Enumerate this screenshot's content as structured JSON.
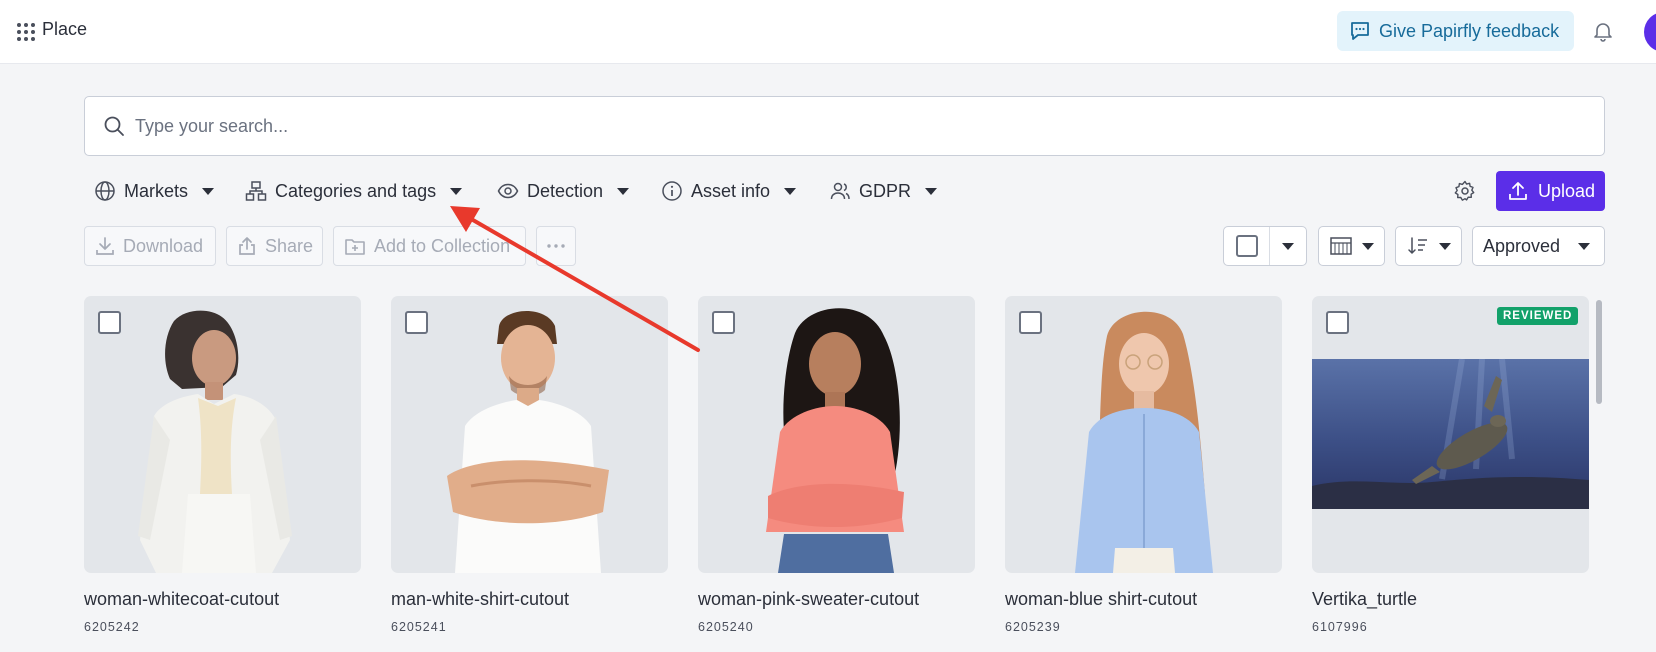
{
  "topbar": {
    "apps_icon": "grid-dots-icon",
    "title": "Place",
    "feedback_label": "Give Papirfly feedback",
    "feedback_icon": "chat-feedback-icon",
    "bell_icon": "bell-icon"
  },
  "search": {
    "placeholder": "Type your search...",
    "value": ""
  },
  "filters": [
    {
      "label": "Markets",
      "icon": "globe-icon"
    },
    {
      "label": "Categories and tags",
      "icon": "hierarchy-icon"
    },
    {
      "label": "Detection",
      "icon": "eye-icon"
    },
    {
      "label": "Asset info",
      "icon": "info-icon"
    },
    {
      "label": "GDPR",
      "icon": "user-icon"
    }
  ],
  "upload_label": "Upload",
  "actions": {
    "download": "Download",
    "share": "Share",
    "add_to_collection": "Add to Collection",
    "more": "more-icon"
  },
  "status_select": {
    "value": "Approved"
  },
  "assets": [
    {
      "name": "woman-whitecoat-cutout",
      "id": "6205242",
      "badge": ""
    },
    {
      "name": "man-white-shirt-cutout",
      "id": "6205241",
      "badge": ""
    },
    {
      "name": "woman-pink-sweater-cutout",
      "id": "6205240",
      "badge": ""
    },
    {
      "name": "woman-blue shirt-cutout",
      "id": "6205239",
      "badge": ""
    },
    {
      "name": "Vertika_turtle",
      "id": "6107996",
      "badge": "REVIEWED"
    }
  ],
  "colors": {
    "accent": "#5b2ee8",
    "feedback_bg": "#e3f3fb",
    "badge_green": "#12a16a",
    "annotation_arrow": "#e8392c"
  }
}
